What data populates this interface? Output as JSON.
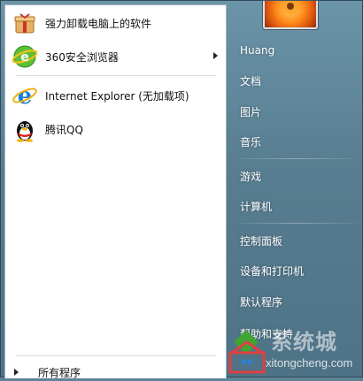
{
  "pinned_programs": [
    {
      "label": "强力卸载电脑上的软件",
      "icon": "uninstall-box-icon"
    },
    {
      "label": "360安全浏览器",
      "icon": "360-browser-icon",
      "submenu": true
    },
    {
      "label": "Internet Explorer (无加载项)",
      "icon": "internet-explorer-icon"
    },
    {
      "label": "腾讯QQ",
      "icon": "qq-penguin-icon"
    }
  ],
  "all_programs_label": "所有程序",
  "right_links": [
    {
      "label": "Huang"
    },
    {
      "label": "文档"
    },
    {
      "label": "图片"
    },
    {
      "label": "音乐"
    },
    {
      "label": "游戏"
    },
    {
      "label": "计算机"
    },
    {
      "label": "控制面板"
    },
    {
      "label": "设备和打印机"
    },
    {
      "label": "默认程序"
    },
    {
      "label": "帮助和支持"
    }
  ],
  "watermark": {
    "brand": "系统城",
    "url": "xitongcheng.com"
  },
  "colors": {
    "right_panel": "#5f8396",
    "left_panel": "#ffffff",
    "watermark_green": "#3fa535",
    "watermark_red": "#e04040"
  }
}
